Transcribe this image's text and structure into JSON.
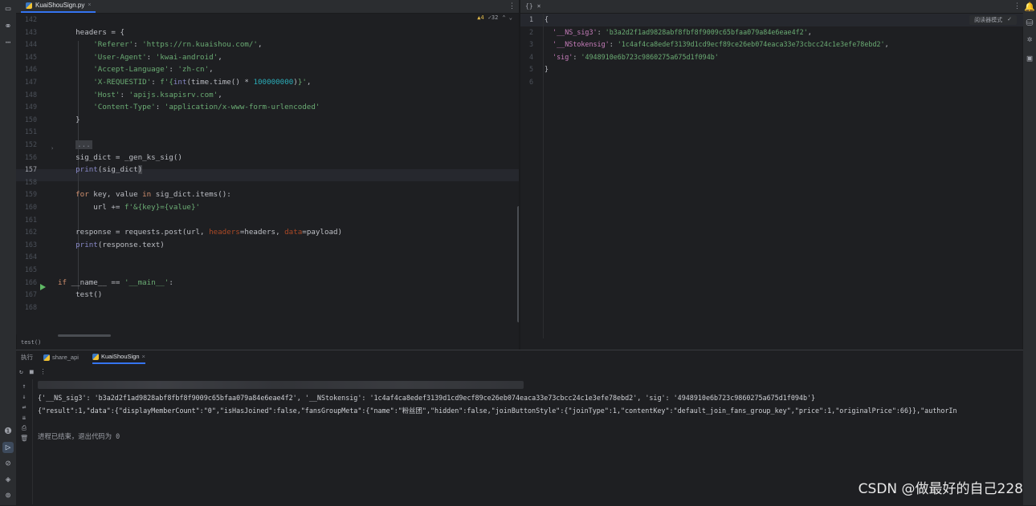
{
  "editor_tab": {
    "filename": "KuaiShouSign.py",
    "close": "×",
    "menu": "⋮"
  },
  "inspection": {
    "warnings": "▲4",
    "ok": "✓32",
    "arrows": "⌃ ⌄"
  },
  "editor": {
    "line_numbers": [
      "142",
      "143",
      "144",
      "145",
      "146",
      "147",
      "148",
      "149",
      "150",
      "151",
      "152",
      "156",
      "157",
      "158",
      "159",
      "160",
      "161",
      "162",
      "163",
      "164",
      "165",
      "166",
      "167",
      "168"
    ],
    "current_line_number": "157",
    "lines": [
      [
        {
          "t": ""
        }
      ],
      [
        {
          "t": "    headers = {"
        }
      ],
      [
        {
          "t": "        "
        },
        {
          "c": "str",
          "t": "'Referer'"
        },
        {
          "t": ": "
        },
        {
          "c": "str",
          "t": "'https://rn.kuaishou.com/'"
        },
        {
          "t": ","
        }
      ],
      [
        {
          "t": "        "
        },
        {
          "c": "str",
          "t": "'User-Agent'"
        },
        {
          "t": ": "
        },
        {
          "c": "str",
          "t": "'kwai-android'"
        },
        {
          "t": ","
        }
      ],
      [
        {
          "t": "        "
        },
        {
          "c": "str",
          "t": "'Accept-Language'"
        },
        {
          "t": ": "
        },
        {
          "c": "str",
          "t": "'zh-cn'"
        },
        {
          "t": ","
        }
      ],
      [
        {
          "t": "        "
        },
        {
          "c": "str",
          "t": "'X-REQUESTID'"
        },
        {
          "t": ": "
        },
        {
          "c": "str",
          "t": "f'{"
        },
        {
          "c": "builtin",
          "t": "int"
        },
        {
          "t": "(time.time() * "
        },
        {
          "c": "num",
          "t": "100000000"
        },
        {
          "t": ")"
        },
        {
          "c": "str",
          "t": "}'"
        },
        {
          "t": ","
        }
      ],
      [
        {
          "t": "        "
        },
        {
          "c": "str",
          "t": "'Host'"
        },
        {
          "t": ": "
        },
        {
          "c": "str",
          "t": "'apijs.ksapisrv.com'"
        },
        {
          "t": ","
        }
      ],
      [
        {
          "t": "        "
        },
        {
          "c": "str",
          "t": "'Content-Type'"
        },
        {
          "t": ": "
        },
        {
          "c": "str",
          "t": "'application/x-www-form-urlencoded'"
        }
      ],
      [
        {
          "t": "    }"
        }
      ],
      [
        {
          "t": ""
        }
      ],
      [
        {
          "t": "    "
        },
        {
          "c": "fold",
          "t": "..."
        }
      ],
      [
        {
          "t": "    sig_dict = _gen_ks_sig()"
        }
      ],
      [
        {
          "t": "    "
        },
        {
          "c": "builtin",
          "t": "print"
        },
        {
          "t": "(sig_dict"
        },
        {
          "c": "brace-hl",
          "t": ")"
        }
      ],
      [
        {
          "t": ""
        }
      ],
      [
        {
          "t": "    "
        },
        {
          "c": "kw",
          "t": "for"
        },
        {
          "t": " key, value "
        },
        {
          "c": "kw",
          "t": "in"
        },
        {
          "t": " sig_dict.items():"
        }
      ],
      [
        {
          "t": "        url += "
        },
        {
          "c": "str",
          "t": "f'&{key}={value}'"
        }
      ],
      [
        {
          "t": ""
        }
      ],
      [
        {
          "t": "    response = requests.post(url, "
        },
        {
          "c": "param",
          "t": "headers"
        },
        {
          "t": "=headers, "
        },
        {
          "c": "param",
          "t": "data"
        },
        {
          "t": "=payload)"
        }
      ],
      [
        {
          "t": "    "
        },
        {
          "c": "builtin",
          "t": "print"
        },
        {
          "t": "(response.text)"
        }
      ],
      [
        {
          "t": ""
        }
      ],
      [
        {
          "t": ""
        }
      ],
      [
        {
          "c": "kw",
          "t": "if"
        },
        {
          "t": " __name__ == "
        },
        {
          "c": "str",
          "t": "'__main__'"
        },
        {
          "t": ":"
        }
      ],
      [
        {
          "t": "    test()"
        }
      ],
      [
        {
          "t": ""
        }
      ]
    ]
  },
  "breadcrumb": "test()",
  "json_panel": {
    "tab_label": "{}",
    "close": "×",
    "menu": "⋮",
    "reader_mode": "阅读器模式",
    "check": "✓",
    "line_numbers": [
      "1",
      "2",
      "3",
      "4",
      "5",
      "6"
    ],
    "lines": [
      [
        {
          "t": "{"
        }
      ],
      [
        {
          "t": "  "
        },
        {
          "c": "jkey",
          "t": "'__NS_sig3'"
        },
        {
          "t": ": "
        },
        {
          "c": "jval",
          "t": "'b3a2d2f1ad9828abf8fbf8f9009c65bfaa079a84e6eae4f2'"
        },
        {
          "t": ","
        }
      ],
      [
        {
          "t": "  "
        },
        {
          "c": "jkey",
          "t": "'__NStokensig'"
        },
        {
          "t": ": "
        },
        {
          "c": "jval",
          "t": "'1c4af4ca8edef3139d1cd9ecf89ce26eb074eaca33e73cbcc24c1e3efe78ebd2'"
        },
        {
          "t": ","
        }
      ],
      [
        {
          "t": "  "
        },
        {
          "c": "jkey",
          "t": "'sig'"
        },
        {
          "t": ": "
        },
        {
          "c": "jval",
          "t": "'4948910e6b723c9860275a675d1f094b'"
        }
      ],
      [
        {
          "t": "}"
        }
      ],
      [
        {
          "t": ""
        }
      ]
    ]
  },
  "run_panel": {
    "tabs": [
      {
        "label": "执行",
        "active": false
      },
      {
        "label": "share_api",
        "active": false
      },
      {
        "label": "KuaiShouSign",
        "active": true
      }
    ],
    "close": "×",
    "toolbar": [
      "↻",
      "■",
      "⋮"
    ],
    "side_icons": [
      "↑",
      "↓",
      "⇌",
      "⇊",
      "⎙",
      "🗑"
    ],
    "output": [
      "{'__NS_sig3': 'b3a2d2f1ad9828abf8fbf8f9009c65bfaa079a84e6eae4f2', '__NStokensig': '1c4af4ca8edef3139d1cd9ecf89ce26eb074eaca33e73cbcc24c1e3efe78ebd2', 'sig': '4948910e6b723c9860275a675d1f094b'}",
      "{\"result\":1,\"data\":{\"displayMemberCount\":\"0\",\"isHasJoined\":false,\"fansGroupMeta\":{\"name\":\"粉丝团\",\"hidden\":false,\"joinButtonStyle\":{\"joinType\":1,\"contentKey\":\"default_join_fans_group_key\",\"price\":1,\"originalPrice\":66}},\"authorIn"
    ],
    "exit_message": "进程已结束，退出代码为 0"
  },
  "left_toolbar_icons": [
    "folder-icon",
    "structure-icon",
    "more-icon",
    "services-icon",
    "run-icon",
    "terminal-icon",
    "problems-icon",
    "python-console-icon",
    "git-icon"
  ],
  "right_toolbar_icons": [
    "notifications-icon",
    "database-icon",
    "copilot-icon",
    "sciview-icon",
    "device-icon"
  ],
  "watermark": "CSDN @做最好的自己228"
}
